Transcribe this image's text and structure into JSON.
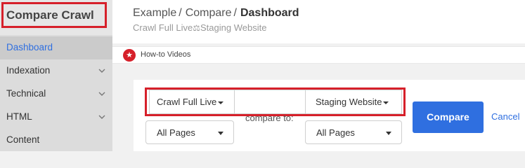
{
  "app": {
    "title": "Compare Crawl"
  },
  "sidebar": {
    "items": [
      {
        "label": "Dashboard",
        "active": true,
        "has_chevron": false
      },
      {
        "label": "Indexation",
        "active": false,
        "has_chevron": true
      },
      {
        "label": "Technical",
        "active": false,
        "has_chevron": true
      },
      {
        "label": "HTML",
        "active": false,
        "has_chevron": true
      },
      {
        "label": "Content",
        "active": false,
        "has_chevron": false
      }
    ]
  },
  "header": {
    "breadcrumb": [
      "Example",
      "Compare",
      "Dashboard"
    ],
    "breadcrumb_separator": "/",
    "subtitle_left": "Crawl Full Live",
    "subtitle_icon": "scale-icon",
    "subtitle_right": "Staging Website"
  },
  "howto": {
    "label": "How-to Videos",
    "icon": "star-icon"
  },
  "compare_form": {
    "left_crawl": "Crawl Full Live",
    "right_crawl": "Staging Website",
    "left_filter": "All Pages",
    "right_filter": "All Pages",
    "compare_to_label": "compare to:",
    "compare_button": "Compare",
    "cancel_link": "Cancel"
  },
  "colors": {
    "accent": "#2f6fe0",
    "highlight": "#d6202a",
    "sidebar_bg": "#dcdcdc"
  }
}
